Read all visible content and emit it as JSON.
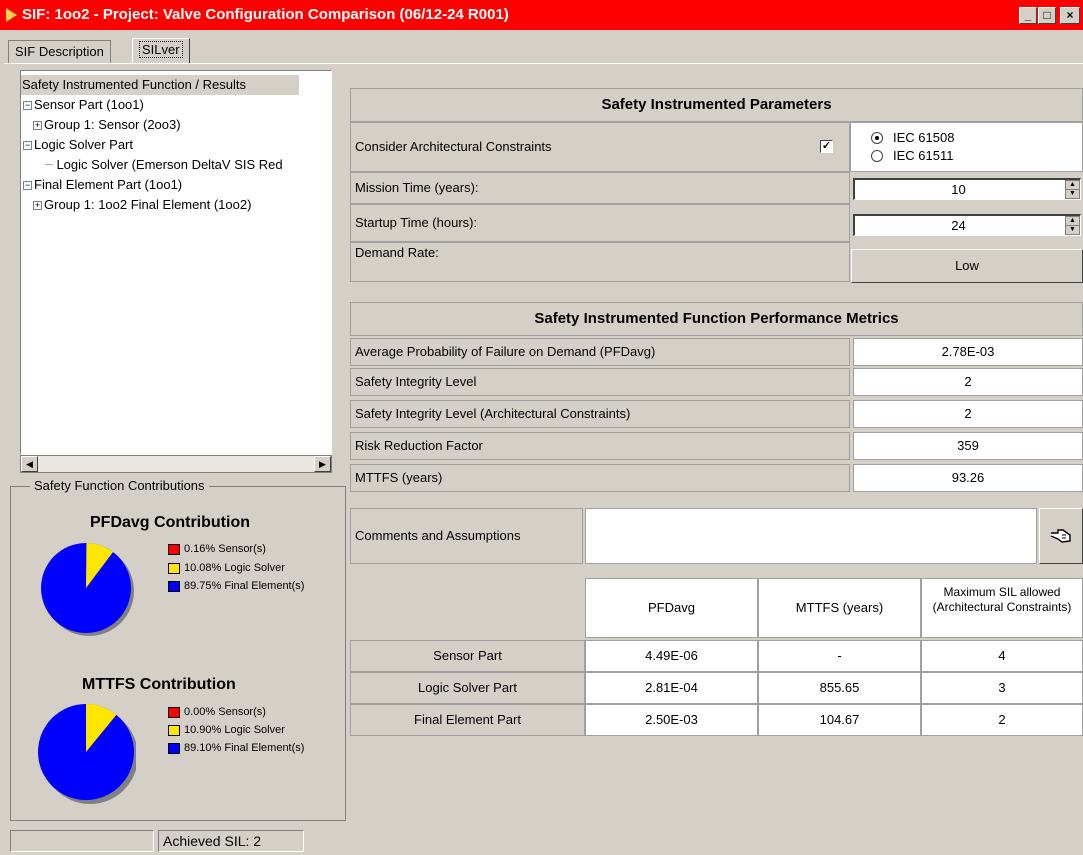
{
  "window": {
    "title": "SIF: 1oo2 - Project: Valve Configuration Comparison (06/12-24 R001)",
    "minimize": "_",
    "maximize": "□",
    "close": "×"
  },
  "tabs": [
    {
      "label": "SIF Description",
      "active": false
    },
    {
      "label": "SILver",
      "active": true
    }
  ],
  "tree": {
    "items": [
      {
        "label": "Safety Instrumented Function / Results",
        "expander": ""
      },
      {
        "label": "Sensor Part (1oo1)",
        "expander": "⊟"
      },
      {
        "label": "Group 1: Sensor (2oo3)",
        "expander": "⊞"
      },
      {
        "label": "Logic Solver Part",
        "expander": "⊟"
      },
      {
        "label": "Logic Solver (Emerson DeltaV SIS Red",
        "expander": ""
      },
      {
        "label": "Final Element Part (1oo1)",
        "expander": "⊟"
      },
      {
        "label": "Group 1: 1oo2 Final Element (1oo2)",
        "expander": "⊞"
      }
    ]
  },
  "contributions": {
    "legend": "Safety Function Contributions",
    "colors": {
      "sensor": "#ff0000",
      "logic": "#ffe600",
      "final": "#0000ff"
    },
    "pfd": {
      "title": "PFDavg Contribution",
      "legend": [
        "0.16% Sensor(s)",
        "10.08% Logic Solver",
        "89.75% Final Element(s)"
      ],
      "values": [
        0.16,
        10.08,
        89.75
      ]
    },
    "mttfs": {
      "title": "MTTFS Contribution",
      "legend": [
        "0.00% Sensor(s)",
        "10.90% Logic Solver",
        "89.10% Final Element(s)"
      ],
      "values": [
        0.0,
        10.9,
        89.1
      ]
    }
  },
  "parameters": {
    "header": "Safety Instrumented Parameters",
    "arch_label": "Consider Architectural Constraints",
    "arch_checked": "✓",
    "iec61508": "IEC 61508",
    "iec61511": "IEC 61511",
    "mission_label": "Mission Time (years):",
    "mission_value": "10",
    "startup_label": "Startup Time (hours):",
    "startup_value": "24",
    "demand_label": "Demand Rate:",
    "demand_value": "Low"
  },
  "metrics": {
    "header": "Safety Instrumented Function Performance Metrics",
    "rows": [
      {
        "label": "Average Probability of Failure on Demand (PFDavg)",
        "value": "2.78E-03"
      },
      {
        "label": "Safety Integrity Level",
        "value": "2"
      },
      {
        "label": "Safety Integrity Level (Architectural Constraints)",
        "value": "2"
      },
      {
        "label": "Risk Reduction Factor",
        "value": "359"
      },
      {
        "label": "MTTFS (years)",
        "value": "93.26"
      }
    ]
  },
  "comments": {
    "label": "Comments and Assumptions",
    "value": ""
  },
  "parts_table": {
    "headers": [
      "PFDavg",
      "MTTFS (years)",
      "Maximum SIL allowed (Architectural Constraints)"
    ],
    "rows": [
      {
        "name": "Sensor Part",
        "pfd": "4.49E-06",
        "mttfs": "-",
        "sil": "4"
      },
      {
        "name": "Logic Solver Part",
        "pfd": "2.81E-04",
        "mttfs": "855.65",
        "sil": "3"
      },
      {
        "name": "Final Element Part",
        "pfd": "2.50E-03",
        "mttfs": "104.67",
        "sil": "2"
      }
    ]
  },
  "status": {
    "left": "",
    "achieved": "Achieved SIL: 2"
  }
}
